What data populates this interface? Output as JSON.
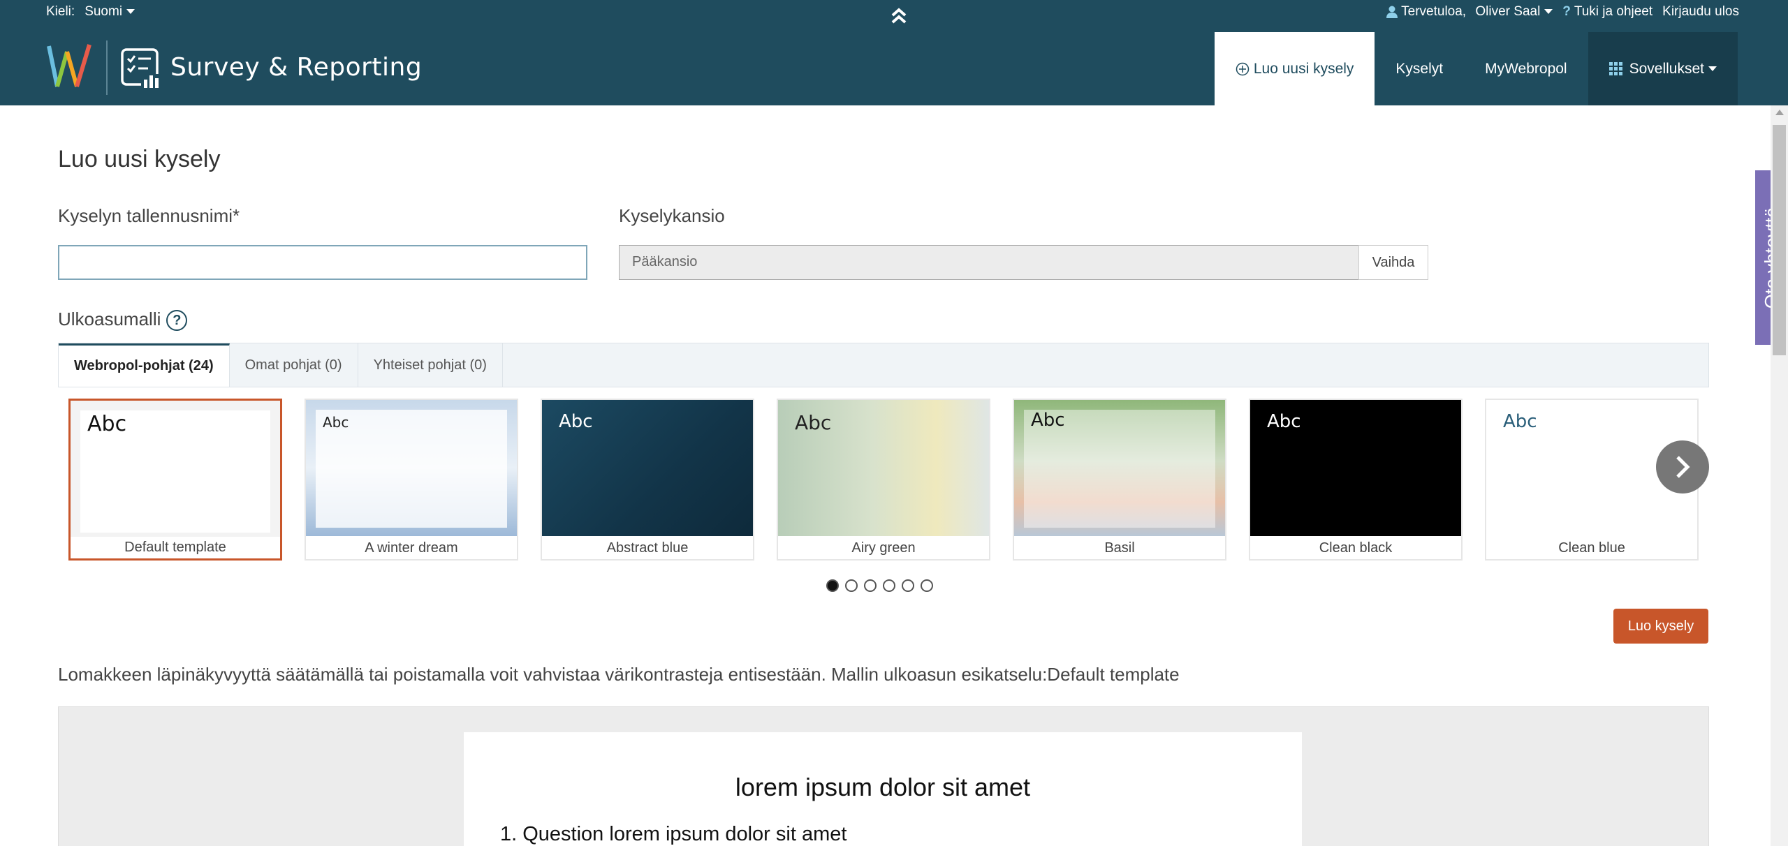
{
  "topbar": {
    "language_label": "Kieli:",
    "language_value": "Suomi",
    "welcome": "Tervetuloa,",
    "user_name": "Oliver Saal",
    "help": "Tuki ja ohjeet",
    "logout": "Kirjaudu ulos"
  },
  "header": {
    "brand": "Survey & Reporting",
    "nav": {
      "create": "Luo uusi kysely",
      "surveys": "Kyselyt",
      "mywebropol": "MyWebropol",
      "apps": "Sovellukset"
    }
  },
  "page": {
    "title": "Luo uusi kysely",
    "name_label": "Kyselyn tallennusnimi*",
    "name_value": "",
    "folder_label": "Kyselykansio",
    "folder_value": "Pääkansio",
    "change_button": "Vaihda",
    "layout_label": "Ulkoasumalli",
    "help_symbol": "?"
  },
  "tabs": [
    {
      "label": "Webropol-pohjat (24)",
      "active": true
    },
    {
      "label": "Omat pohjat (0)",
      "active": false
    },
    {
      "label": "Yhteiset pohjat (0)",
      "active": false
    }
  ],
  "templates": [
    {
      "name": "Default template",
      "abc": "Abc",
      "selected": true
    },
    {
      "name": "A winter dream",
      "abc": "Abc",
      "selected": false
    },
    {
      "name": "Abstract blue",
      "abc": "Abc",
      "selected": false
    },
    {
      "name": "Airy green",
      "abc": "Abc",
      "selected": false
    },
    {
      "name": "Basil",
      "abc": "Abc",
      "selected": false
    },
    {
      "name": "Clean black",
      "abc": "Abc",
      "selected": false
    },
    {
      "name": "Clean blue",
      "abc": "Abc",
      "selected": false
    }
  ],
  "carousel": {
    "page_count": 6,
    "active_page": 1
  },
  "create_button": "Luo kysely",
  "info_text": "Lomakkeen läpinäkyvyyttä säätämällä tai poistamalla voit vahvistaa värikontrasteja entisestään. Mallin ulkoasun esikatselu:Default template",
  "preview": {
    "title": "lorem ipsum dolor sit amet",
    "question": "1. Question lorem ipsum dolor sit amet"
  },
  "feedback_tab": "Ota yhteyttä",
  "colors": {
    "header_bg": "#1f4c5e",
    "accent_orange": "#c8562a",
    "feedback_purple": "#7b6fb6"
  }
}
